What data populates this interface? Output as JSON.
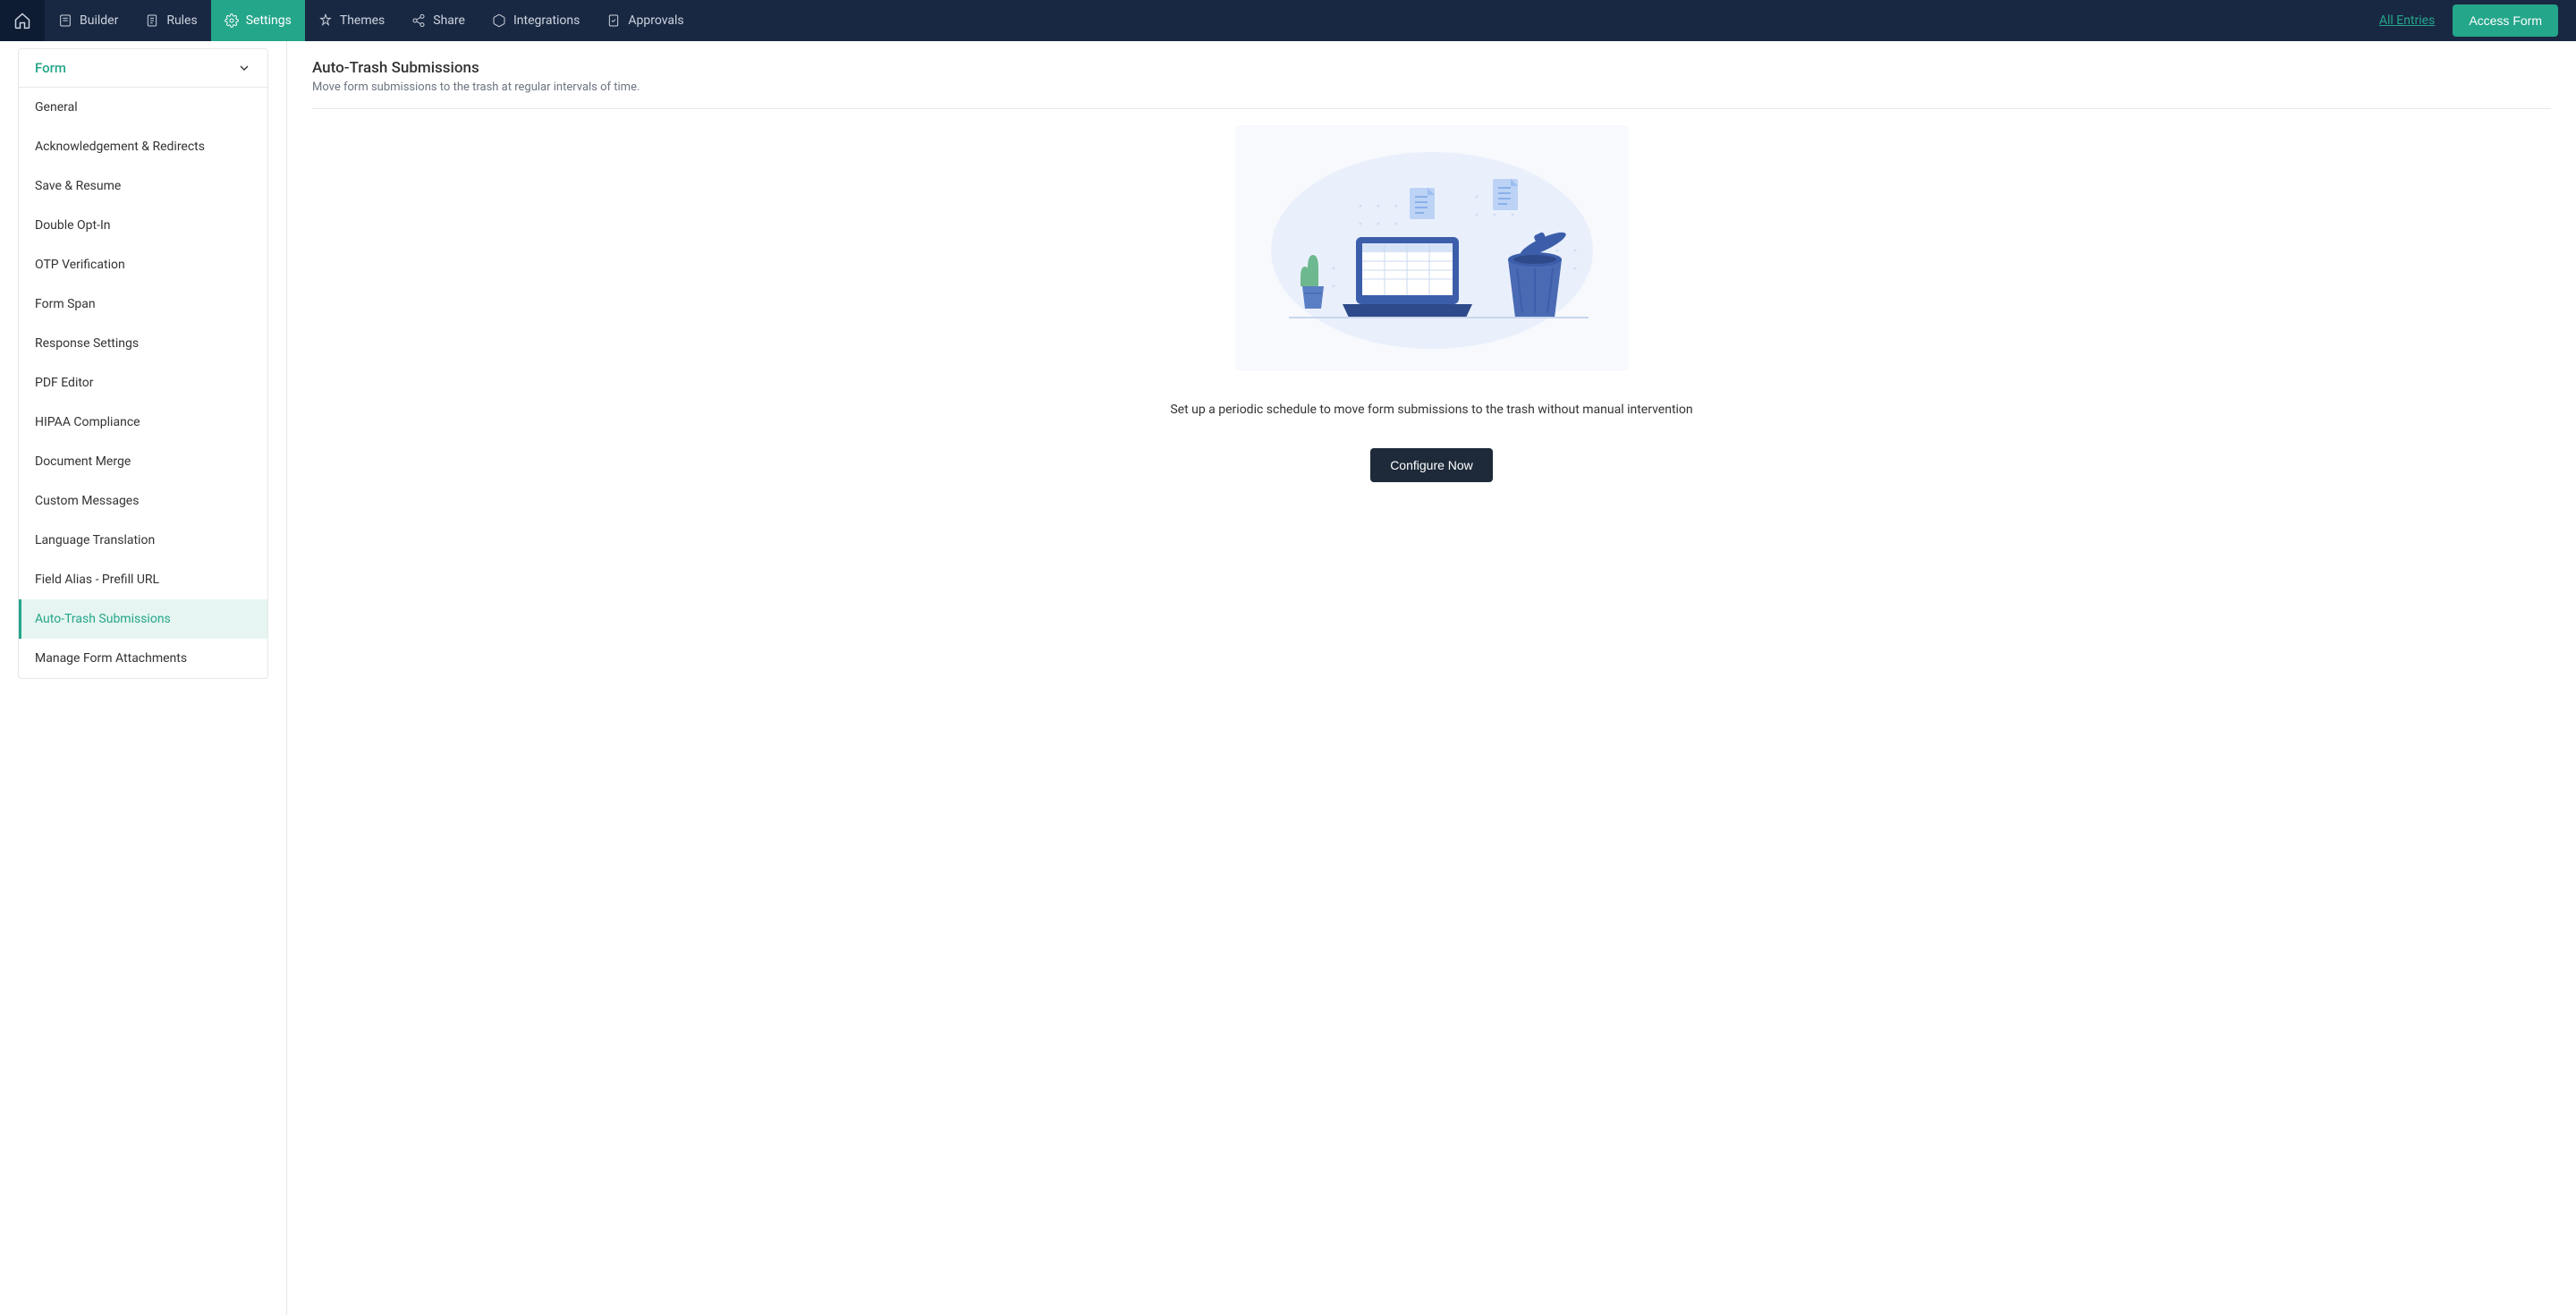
{
  "nav": {
    "items": [
      {
        "label": "Builder"
      },
      {
        "label": "Rules"
      },
      {
        "label": "Settings"
      },
      {
        "label": "Themes"
      },
      {
        "label": "Share"
      },
      {
        "label": "Integrations"
      },
      {
        "label": "Approvals"
      }
    ],
    "all_entries": "All Entries",
    "access_form": "Access Form"
  },
  "sidebar": {
    "section_title": "Form",
    "items": [
      {
        "label": "General"
      },
      {
        "label": "Acknowledgement & Redirects"
      },
      {
        "label": "Save & Resume"
      },
      {
        "label": "Double Opt-In"
      },
      {
        "label": "OTP Verification"
      },
      {
        "label": "Form Span"
      },
      {
        "label": "Response Settings"
      },
      {
        "label": "PDF Editor"
      },
      {
        "label": "HIPAA Compliance"
      },
      {
        "label": "Document Merge"
      },
      {
        "label": "Custom Messages"
      },
      {
        "label": "Language Translation"
      },
      {
        "label": "Field Alias - Prefill URL"
      },
      {
        "label": "Auto-Trash Submissions"
      },
      {
        "label": "Manage Form Attachments"
      }
    ]
  },
  "main": {
    "title": "Auto-Trash Submissions",
    "subtitle": "Move form submissions to the trash at regular intervals of time.",
    "empty_description": "Set up a periodic schedule to move form submissions to the trash without manual intervention",
    "configure_label": "Configure Now"
  }
}
